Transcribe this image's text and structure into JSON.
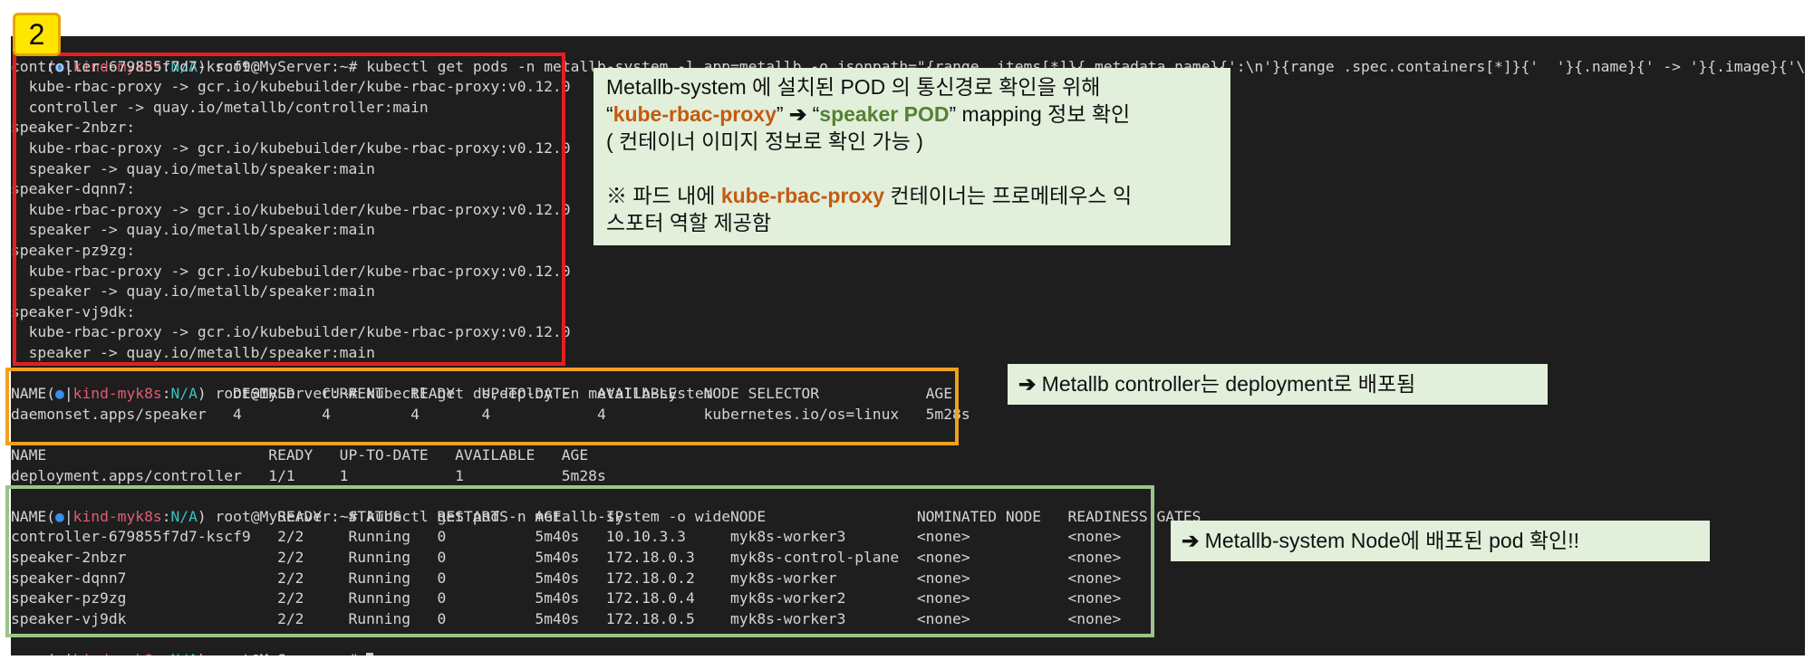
{
  "step_badge": "2",
  "prompt": {
    "open": "(",
    "dot": "●",
    "sep": "|",
    "context": "kind-myk8s",
    "colon": ":",
    "namespace": "N/A",
    "close": ")",
    "user_host": " root@MyServer:~#"
  },
  "commands": {
    "jsonpath": "kubectl get pods -n metallb-system -l app=metallb -o jsonpath=\"{range .items[*]}{.metadata.name}{':\\n'}{range .spec.containers[*]}{'  '}{.name}{' -> '}{.image}{'\\n'}{end}{end}\"",
    "ds_deploy": "kubectl get ds,deploy -n metallb-system",
    "pods_wide": "kubectl get pod -n metallb-system -o wide"
  },
  "jsonpath_output": [
    "controller-679855f7d7-kscf9:",
    "  kube-rbac-proxy -> gcr.io/kubebuilder/kube-rbac-proxy:v0.12.0",
    "  controller -> quay.io/metallb/controller:main",
    "speaker-2nbzr:",
    "  kube-rbac-proxy -> gcr.io/kubebuilder/kube-rbac-proxy:v0.12.0",
    "  speaker -> quay.io/metallb/speaker:main",
    "speaker-dqnn7:",
    "  kube-rbac-proxy -> gcr.io/kubebuilder/kube-rbac-proxy:v0.12.0",
    "  speaker -> quay.io/metallb/speaker:main",
    "speaker-pz9zg:",
    "  kube-rbac-proxy -> gcr.io/kubebuilder/kube-rbac-proxy:v0.12.0",
    "  speaker -> quay.io/metallb/speaker:main",
    "speaker-vj9dk:",
    "  kube-rbac-proxy -> gcr.io/kubebuilder/kube-rbac-proxy:v0.12.0",
    "  speaker -> quay.io/metallb/speaker:main"
  ],
  "ds_table": {
    "header": "NAME                     DESIRED   CURRENT   READY   UP-TO-DATE   AVAILABLE   NODE SELECTOR            AGE",
    "row": "daemonset.apps/speaker   4         4         4       4            4           kubernetes.io/os=linux   5m28s"
  },
  "deploy_table": {
    "header": "NAME                         READY   UP-TO-DATE   AVAILABLE   AGE",
    "row": "deployment.apps/controller   1/1     1            1           5m28s"
  },
  "pod_table": {
    "header": "NAME                          READY   STATUS    RESTARTS   AGE     IP            NODE                 NOMINATED NODE   READINESS GATES",
    "rows": [
      "controller-679855f7d7-kscf9   2/2     Running   0          5m40s   10.10.3.3     myk8s-worker3        <none>           <none>",
      "speaker-2nbzr                 2/2     Running   0          5m40s   172.18.0.3    myk8s-control-plane  <none>           <none>",
      "speaker-dqnn7                 2/2     Running   0          5m40s   172.18.0.2    myk8s-worker         <none>           <none>",
      "speaker-pz9zg                 2/2     Running   0          5m40s   172.18.0.4    myk8s-worker2        <none>           <none>",
      "speaker-vj9dk                 2/2     Running   0          5m40s   172.18.0.5    myk8s-worker3        <none>           <none>"
    ]
  },
  "notes": {
    "note1": {
      "l1": "Metallb-system 에 설치된 POD 의 통신경로 확인을 위해",
      "l2_q1": " “",
      "l2_orange": "kube-rbac-proxy",
      "l2_q2": "” ",
      "l2_arrow": "➔",
      "l2_q3": " “",
      "l2_green": "speaker POD",
      "l2_rest": "” mapping 정보 확인",
      "l3": "( 컨테이너 이미지 정보로 확인 가능 )",
      "l5_pre": "※ 파드 내에 ",
      "l5_orange": "kube-rbac-proxy",
      "l5_post": " 컨테이너는 프로메테우스 익",
      "l6": "스포터 역할 제공함"
    },
    "note2": {
      "arrow": "➔",
      "text": " Metallb controller는 deployment로 배포됨"
    },
    "note3": {
      "arrow": "➔",
      "text": " Metallb-system Node에 배포된 pod 확인!!"
    }
  },
  "colors": {
    "terminal_bg": "#1e1e1e",
    "red_box": "#e61e1e",
    "orange_box": "#f0a020",
    "green_box": "#9bc48a",
    "note_bg": "#e2efda",
    "badge": "#ffe600"
  }
}
